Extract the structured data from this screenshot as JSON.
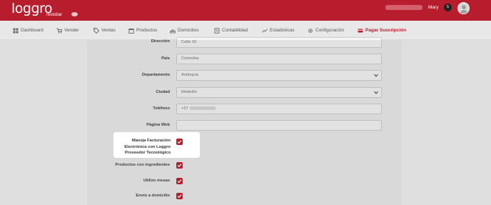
{
  "topbar": {
    "logo": "loggro",
    "logo_sub": "restobar",
    "user_name": "Mary",
    "badge_count": "5"
  },
  "nav": {
    "items": [
      {
        "label": "Dashboard",
        "icon": "dashboard-icon"
      },
      {
        "label": "Vender",
        "icon": "cart-icon"
      },
      {
        "label": "Ventas",
        "icon": "tag-icon"
      },
      {
        "label": "Productos",
        "icon": "box-icon"
      },
      {
        "label": "Domicilios",
        "icon": "bike-icon"
      },
      {
        "label": "Contabilidad",
        "icon": "book-icon"
      },
      {
        "label": "Estadisticas",
        "icon": "chart-icon"
      },
      {
        "label": "Configuración",
        "icon": "gear-icon"
      },
      {
        "label": "Pagar Suscripción",
        "icon": "credit-card-icon",
        "active": true
      }
    ]
  },
  "form": {
    "direccion": {
      "label": "Dirección",
      "value": "Calle 10"
    },
    "pais": {
      "label": "País",
      "value": "Colombia"
    },
    "departamento": {
      "label": "Departamento",
      "value": "Antioquia"
    },
    "ciudad": {
      "label": "Ciudad",
      "value": "Medellín"
    },
    "telefono": {
      "label": "Teléfono",
      "value": "+57"
    },
    "pagina_web": {
      "label": "Página Web",
      "value": ""
    },
    "facturacion": {
      "label_line1": "Maneja Facturación",
      "label_line2": "Electrónica con Loggro",
      "label_line3": "Proveedor Tecnológico",
      "checked": true
    },
    "ingredientes": {
      "label": "Productos con ingredientes",
      "checked": true
    },
    "mesas": {
      "label": "Utilizo mesas",
      "checked": true
    },
    "domicilio": {
      "label": "Envío a domicilio",
      "checked": true
    }
  },
  "colors": {
    "brand": "#b81d2e",
    "nav_bg": "#e8e8e8",
    "page_bg": "#f2f2f2"
  }
}
